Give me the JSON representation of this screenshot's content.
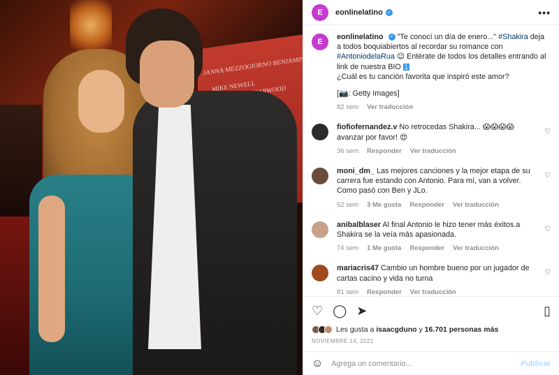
{
  "header": {
    "username": "eonlinelatino",
    "avatar_letter": "E",
    "verified": "✓",
    "more": "•••"
  },
  "photo": {
    "backdrop_text_1": "JANNA MEZZOGIORNO  BENJAMIN",
    "backdrop_text_2": "MIKE NEWELL",
    "backdrop_text_3": "RONALD HARWOOD"
  },
  "caption": {
    "username": "eonlinelatino",
    "text_1": " \"Te conocí un día de enero...\" ",
    "hashtag_1": "#Shakira",
    "text_2": " deja a todos boquiabiertos al recordar su romance con ",
    "hashtag_2": "#AntoniodelaRua",
    "text_3": " 😉 Entérate de todos los detalles entrando al link de nuestra BIO ",
    "bio_badge": "1",
    "text_4": "¿Cuál es tu canción favorita que inspiró este amor?",
    "text_5": "[📷: Getty Images]",
    "time": "82 sem",
    "translate": "Ver traducción"
  },
  "comments": [
    {
      "username": "fiofiofernandez.v",
      "text": "No retrocedas Shakira... 😱😱😱😱 avanzar por favor! 😍",
      "time": "36 sem",
      "likes": "",
      "reply": "Responder",
      "translate": "Ver traducción",
      "color": "#2b2b2b"
    },
    {
      "username": "moni_dm_",
      "text": "Las mejores canciones y la mejor etapa de su carrera fue estando con Antonio. Para mí, van a volver. Como pasó con Ben y JLo.",
      "time": "52 sem",
      "likes": "3 Me gusta",
      "reply": "Responder",
      "translate": "Ver traducción",
      "color": "#6b4b3a"
    },
    {
      "username": "anibalblaser",
      "text": "Al final Antonio le hizo tener más éxitos.a Shakira se la veía más apasionada.",
      "time": "74 sem",
      "likes": "1 Me gusta",
      "reply": "Responder",
      "translate": "Ver traducción",
      "color": "#c9a08a"
    },
    {
      "username": "mariacris47",
      "text": "Cambio un hombre bueno por un jugador de cartas cacino y vida no turna",
      "time": "81 sem",
      "likes": "",
      "reply": "Responder",
      "translate": "Ver traducción",
      "color": "#a04a20"
    }
  ],
  "actions": {
    "like_icon": "♡",
    "comment_icon": "◯",
    "share_icon": "➤",
    "save_icon": "▯"
  },
  "likes": {
    "prefix": "Les gusta a ",
    "user": "isaacgduno",
    "middle": " y ",
    "count": "16.701 personas más"
  },
  "date": "NOVIEMBRE 14, 2021",
  "comment_box": {
    "emoji": "☺",
    "placeholder": "Agrega un comentario...",
    "post": "Publicar"
  }
}
